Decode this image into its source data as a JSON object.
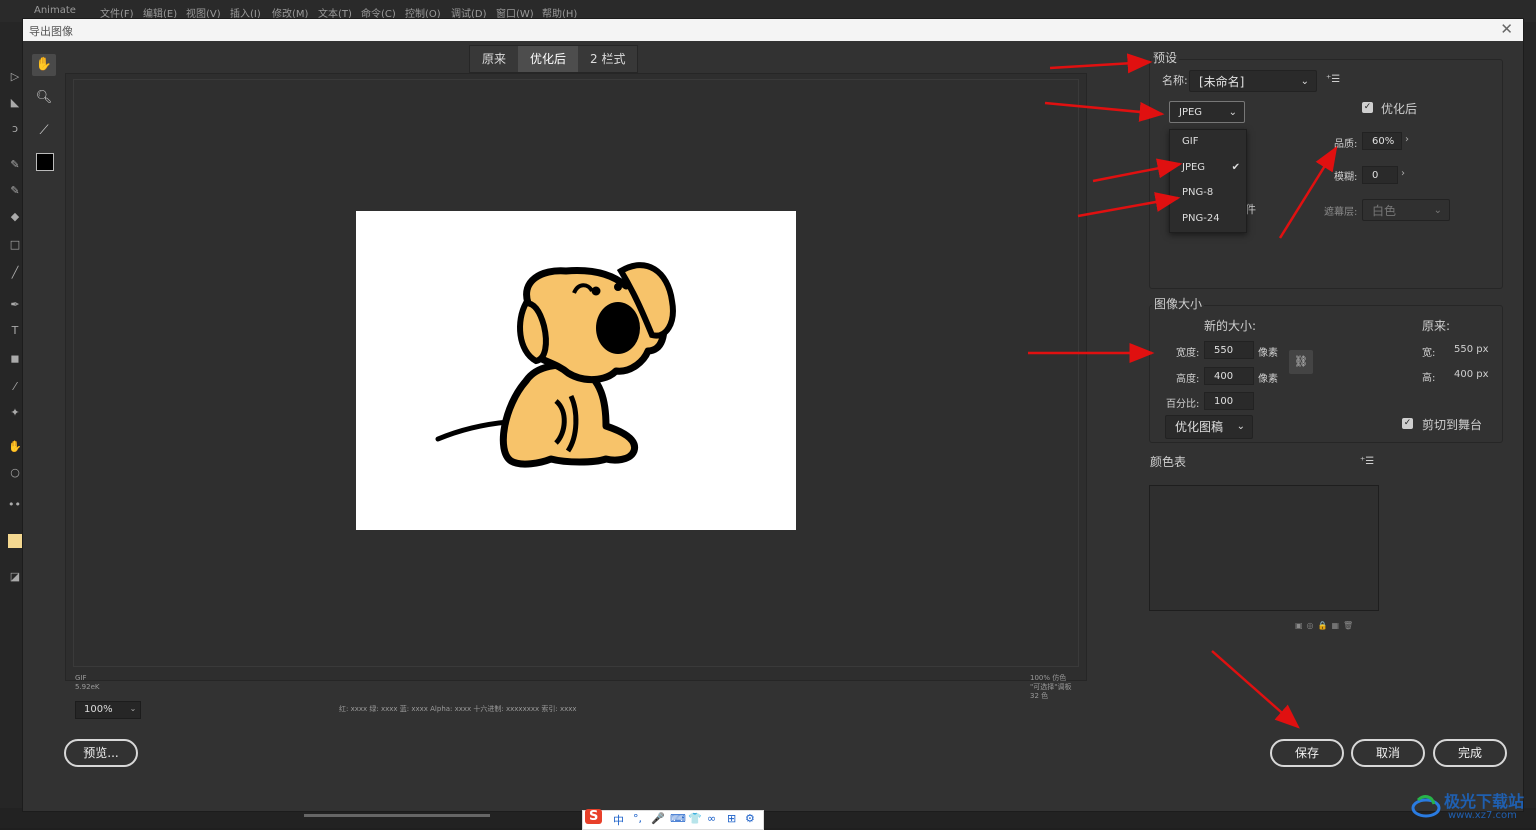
{
  "app": {
    "name": "Animate",
    "menu": [
      "文件(F)",
      "编辑(E)",
      "视图(V)",
      "插入(I)",
      "修改(M)",
      "文本(T)",
      "命令(C)",
      "控制(O)",
      "调试(D)",
      "窗口(W)",
      "帮助(H)"
    ]
  },
  "dialog": {
    "title": "导出图像",
    "close_icon": "close-icon",
    "view_tabs": [
      {
        "label": "原来",
        "active": false
      },
      {
        "label": "优化后",
        "active": true
      },
      {
        "label": "2 栏式",
        "active": false
      }
    ],
    "tools": [
      "hand-icon",
      "zoom-icon",
      "eyedropper-icon"
    ],
    "image_info": {
      "format": "GIF",
      "size": "5.92eK",
      "right_info": "100% 仿色\n\"可选择\"调板\n32 色"
    },
    "zoom": "100%",
    "pixel_readout": "红: xxxx 绿: xxxx 蓝: xxxx Alpha: xxxx 十六进制: xxxxxxxx 索引: xxxx",
    "buttons": {
      "preview": "预览...",
      "save": "保存",
      "cancel": "取消",
      "done": "完成"
    },
    "preset": {
      "title": "预设",
      "name_label": "名称:",
      "name_value": "[未命名]",
      "format_value": "JPEG",
      "optimized_label": "优化后",
      "optimized_checked": true,
      "quality_label": "品质:",
      "quality_value": "60%",
      "blur_label": "模糊:",
      "blur_value": "0",
      "matte_label": "遮幕层:",
      "matte_value": "白色",
      "partial_text": "件",
      "format_options": [
        {
          "label": "GIF",
          "checked": false
        },
        {
          "label": "JPEG",
          "checked": true
        },
        {
          "label": "PNG-8",
          "checked": false
        },
        {
          "label": "PNG-24",
          "checked": false
        }
      ]
    },
    "image_size": {
      "title": "图像大小",
      "new_size_label": "新的大小:",
      "original_label": "原来:",
      "width_label": "宽度:",
      "width_value": "550",
      "height_label": "高度:",
      "height_value": "400",
      "unit": "像素",
      "percent_label": "百分比:",
      "percent_value": "100",
      "orig_width_label": "宽:",
      "orig_width_value": "550 px",
      "orig_height_label": "高:",
      "orig_height_value": "400 px",
      "optimize_dropdown": "优化图稿",
      "clip_label": "剪切到舞台",
      "clip_checked": true
    },
    "color_table": {
      "title": "颜色表"
    }
  },
  "ime": {
    "items": [
      "S",
      "中",
      "°,",
      "🎤",
      "⌨",
      "👕",
      "∞",
      "⊞",
      "⚙"
    ]
  },
  "watermark": {
    "title": "极光下载站",
    "url": "www.xz7.com"
  }
}
